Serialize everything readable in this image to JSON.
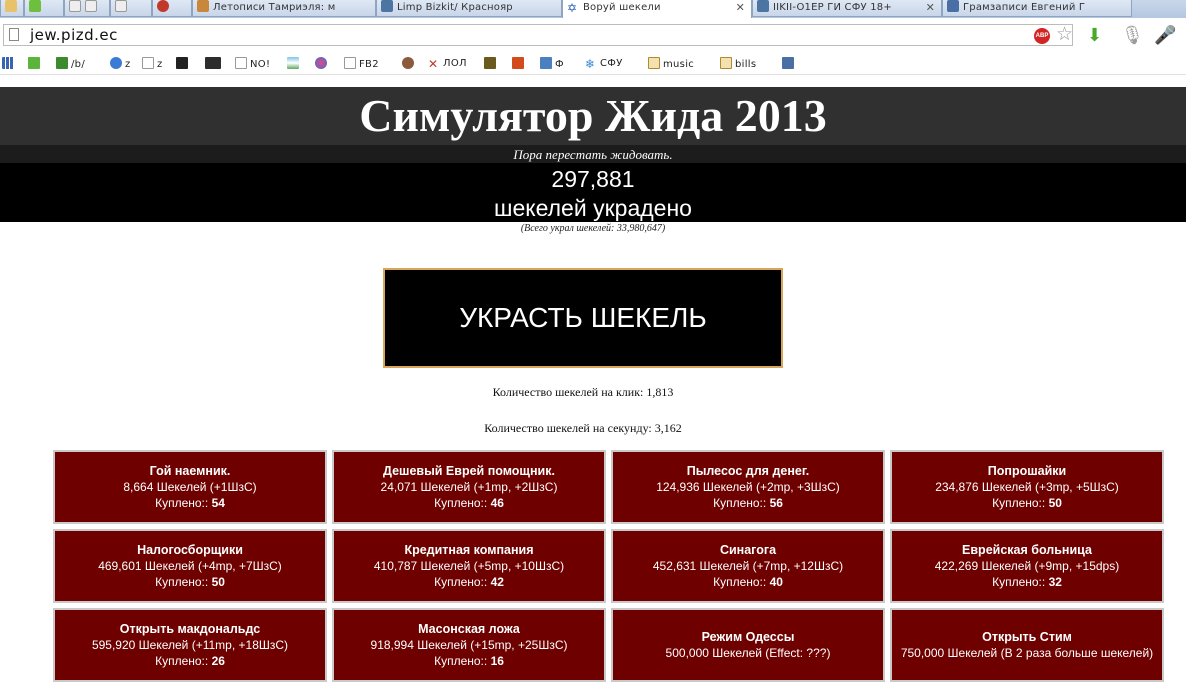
{
  "browser": {
    "tabs": [
      {
        "title": ""
      },
      {
        "title": ""
      },
      {
        "title": ""
      },
      {
        "title": "Летописи Тамриэля: м"
      },
      {
        "title": "Limp Bizkit/ Краснояр"
      },
      {
        "title": "Воруй шекели"
      },
      {
        "title": "IIKII-O1EP ГИ СФУ 18+"
      },
      {
        "title": "Грамзаписи Евгений Г"
      }
    ],
    "url": "jew.pizd.ec",
    "adblock_label": "ABP",
    "bookmarks": [
      {
        "label": ""
      },
      {
        "label": ""
      },
      {
        "label": "/b/"
      },
      {
        "label": "z"
      },
      {
        "label": "z"
      },
      {
        "label": ""
      },
      {
        "label": ""
      },
      {
        "label": "NO!"
      },
      {
        "label": ""
      },
      {
        "label": ""
      },
      {
        "label": "FB2"
      },
      {
        "label": ""
      },
      {
        "label": "ЛОЛ"
      },
      {
        "label": ""
      },
      {
        "label": ""
      },
      {
        "label": "Ф"
      },
      {
        "label": "СФУ"
      },
      {
        "label": "music"
      },
      {
        "label": "bills"
      },
      {
        "label": ""
      }
    ]
  },
  "page": {
    "title": "Симулятор Жида 2013",
    "subtitle": "Пора перестать жидовать.",
    "count": "297,881",
    "count_label": "шекелей украдено",
    "total": "(Всего украл шекелей: 33,980,647)",
    "steal_button": "УКРАСТЬ ШЕКЕЛЬ",
    "per_click": "Количество шекелей на клик: 1,813",
    "per_second": "Количество шекелей на секунду: 3,162"
  },
  "upgrades": [
    {
      "name": "Гой наемник.",
      "cost": "8,664 Шекелей (+1ШзС)",
      "bought_label": "Куплено::",
      "bought": "54"
    },
    {
      "name": "Дешевый Еврей помощник.",
      "cost": "24,071 Шекелей (+1mp, +2ШзС)",
      "bought_label": "Куплено::",
      "bought": "46"
    },
    {
      "name": "Пылесос для денег.",
      "cost": "124,936 Шекелей (+2mp, +3ШзС)",
      "bought_label": "Куплено::",
      "bought": "56"
    },
    {
      "name": "Попрошайки",
      "cost": "234,876 Шекелей (+3mp, +5ШзС)",
      "bought_label": "Куплено::",
      "bought": "50"
    },
    {
      "name": "Налогосборщики",
      "cost": "469,601 Шекелей (+4mp, +7ШзС)",
      "bought_label": "Куплено::",
      "bought": "50"
    },
    {
      "name": "Кредитная компания",
      "cost": "410,787 Шекелей (+5mp, +10ШзС)",
      "bought_label": "Куплено::",
      "bought": "42"
    },
    {
      "name": "Синагога",
      "cost": "452,631 Шекелей (+7mp, +12ШзС)",
      "bought_label": "Куплено::",
      "bought": "40"
    },
    {
      "name": "Еврейская больница",
      "cost": "422,269 Шекелей (+9mp, +15dps)",
      "bought_label": "Куплено::",
      "bought": "32"
    },
    {
      "name": "Открыть макдональдс",
      "cost": "595,920 Шекелей (+11mp, +18ШзС)",
      "bought_label": "Куплено::",
      "bought": "26"
    },
    {
      "name": "Масонская ложа",
      "cost": "918,994 Шекелей (+15mp, +25ШзС)",
      "bought_label": "Куплено::",
      "bought": "16"
    },
    {
      "name": "Режим Одессы",
      "cost": "500,000 Шекелей (Effect: ???)"
    },
    {
      "name": "Открыть Стим",
      "cost": "750,000 Шекелей (В 2 раза больше шекелей)"
    }
  ]
}
